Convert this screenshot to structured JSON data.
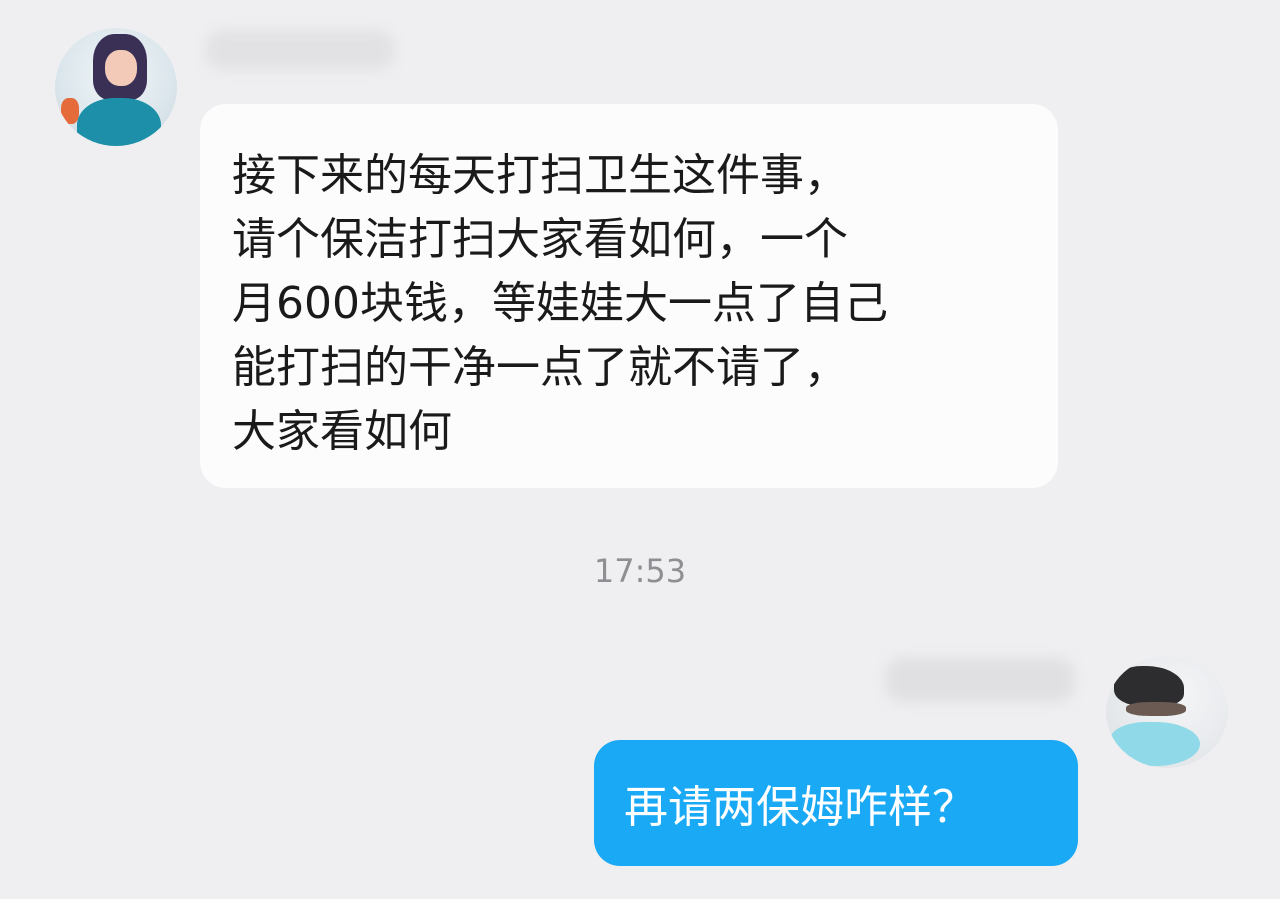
{
  "conversation": {
    "incoming": {
      "lines": [
        "接下来的每天打扫卫生这件事，",
        "请个保洁打扫大家看如何，一个",
        "月600块钱，等娃娃大一点了自己",
        "能打扫的干净一点了就不请了，",
        "大家看如何"
      ]
    },
    "timestamp": "17:53",
    "outgoing": {
      "text": "再请两保姆咋样？"
    }
  },
  "colors": {
    "background": "#efeff1",
    "incoming_bubble": "#fcfcfc",
    "outgoing_bubble": "#1aa9f5",
    "timestamp_text": "#8f8f93"
  }
}
